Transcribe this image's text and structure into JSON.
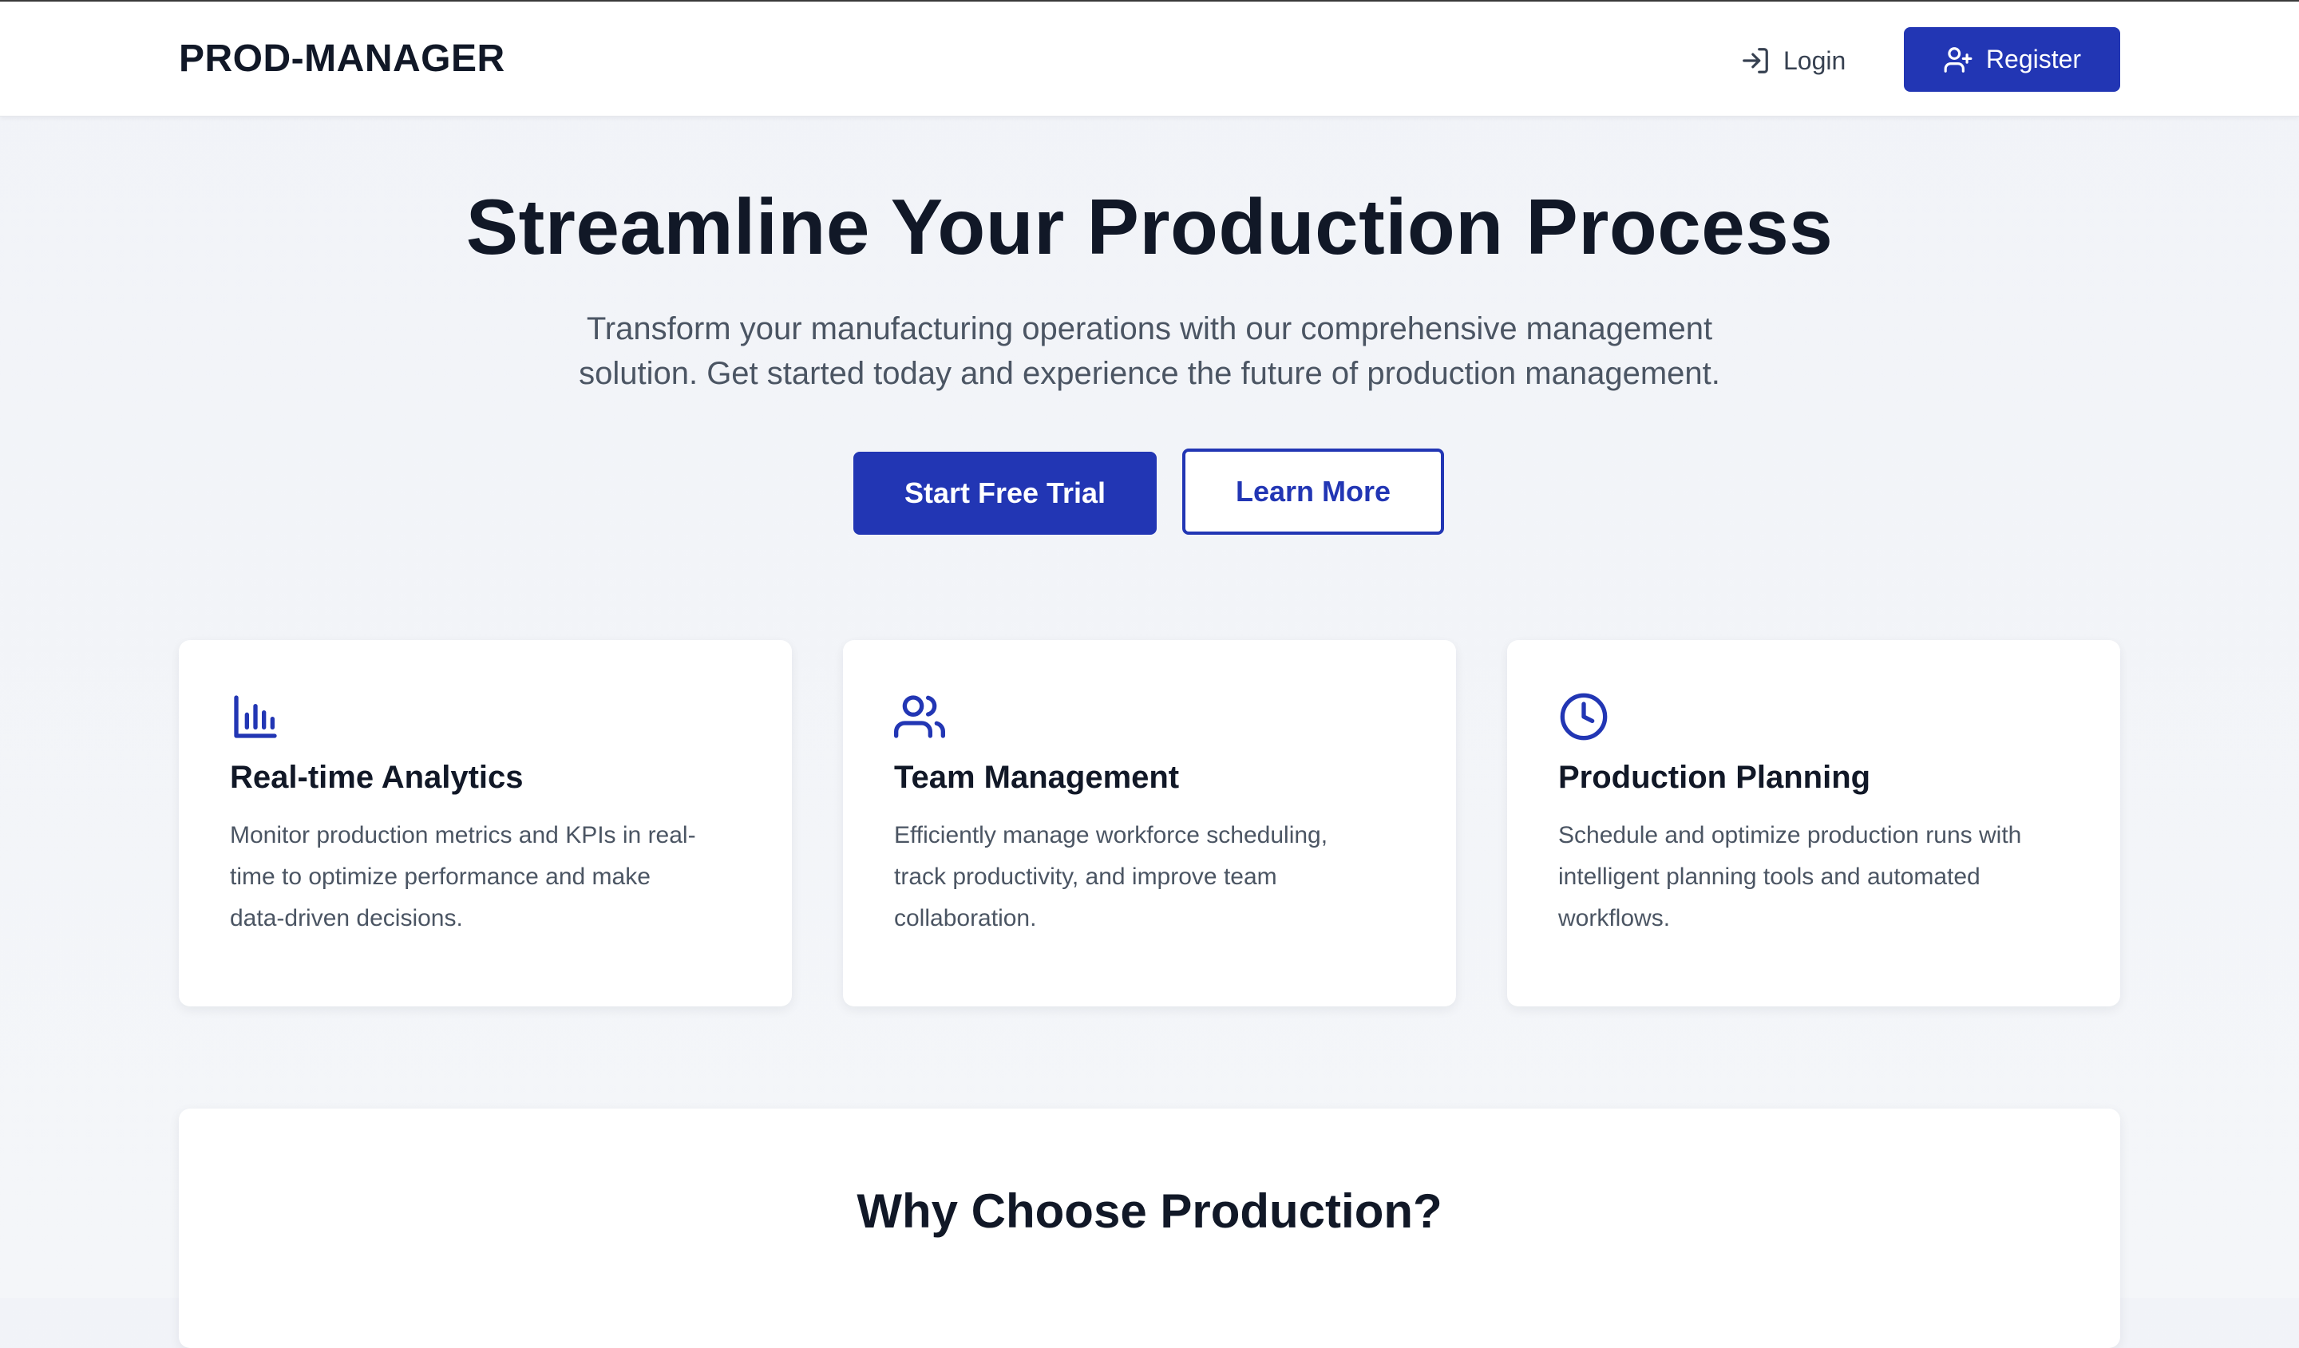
{
  "header": {
    "brand": "PROD-MANAGER",
    "login_label": "Login",
    "register_label": "Register"
  },
  "hero": {
    "title": "Streamline Your Production Process",
    "subtitle_line1": "Transform your manufacturing operations with our comprehensive management",
    "subtitle_line2": "solution. Get started today and experience the future of production management.",
    "primary_cta": "Start Free Trial",
    "secondary_cta": "Learn More"
  },
  "features": [
    {
      "icon": "bar-chart-icon",
      "title": "Real-time Analytics",
      "lines": [
        "Monitor production metrics and KPIs in real-",
        "time to optimize performance and make",
        "data-driven decisions."
      ]
    },
    {
      "icon": "users-icon",
      "title": "Team Management",
      "lines": [
        "Efficiently manage workforce scheduling,",
        "track productivity, and improve team",
        "collaboration."
      ]
    },
    {
      "icon": "clock-icon",
      "title": "Production Planning",
      "lines": [
        "Schedule and optimize production runs with",
        "intelligent planning tools and automated",
        "workflows."
      ]
    }
  ],
  "why": {
    "title": "Why Choose Production?"
  },
  "colors": {
    "accent": "#2236b4",
    "text_dark": "#111827",
    "text_muted": "#4b5563",
    "background": "#f3f5f9"
  }
}
